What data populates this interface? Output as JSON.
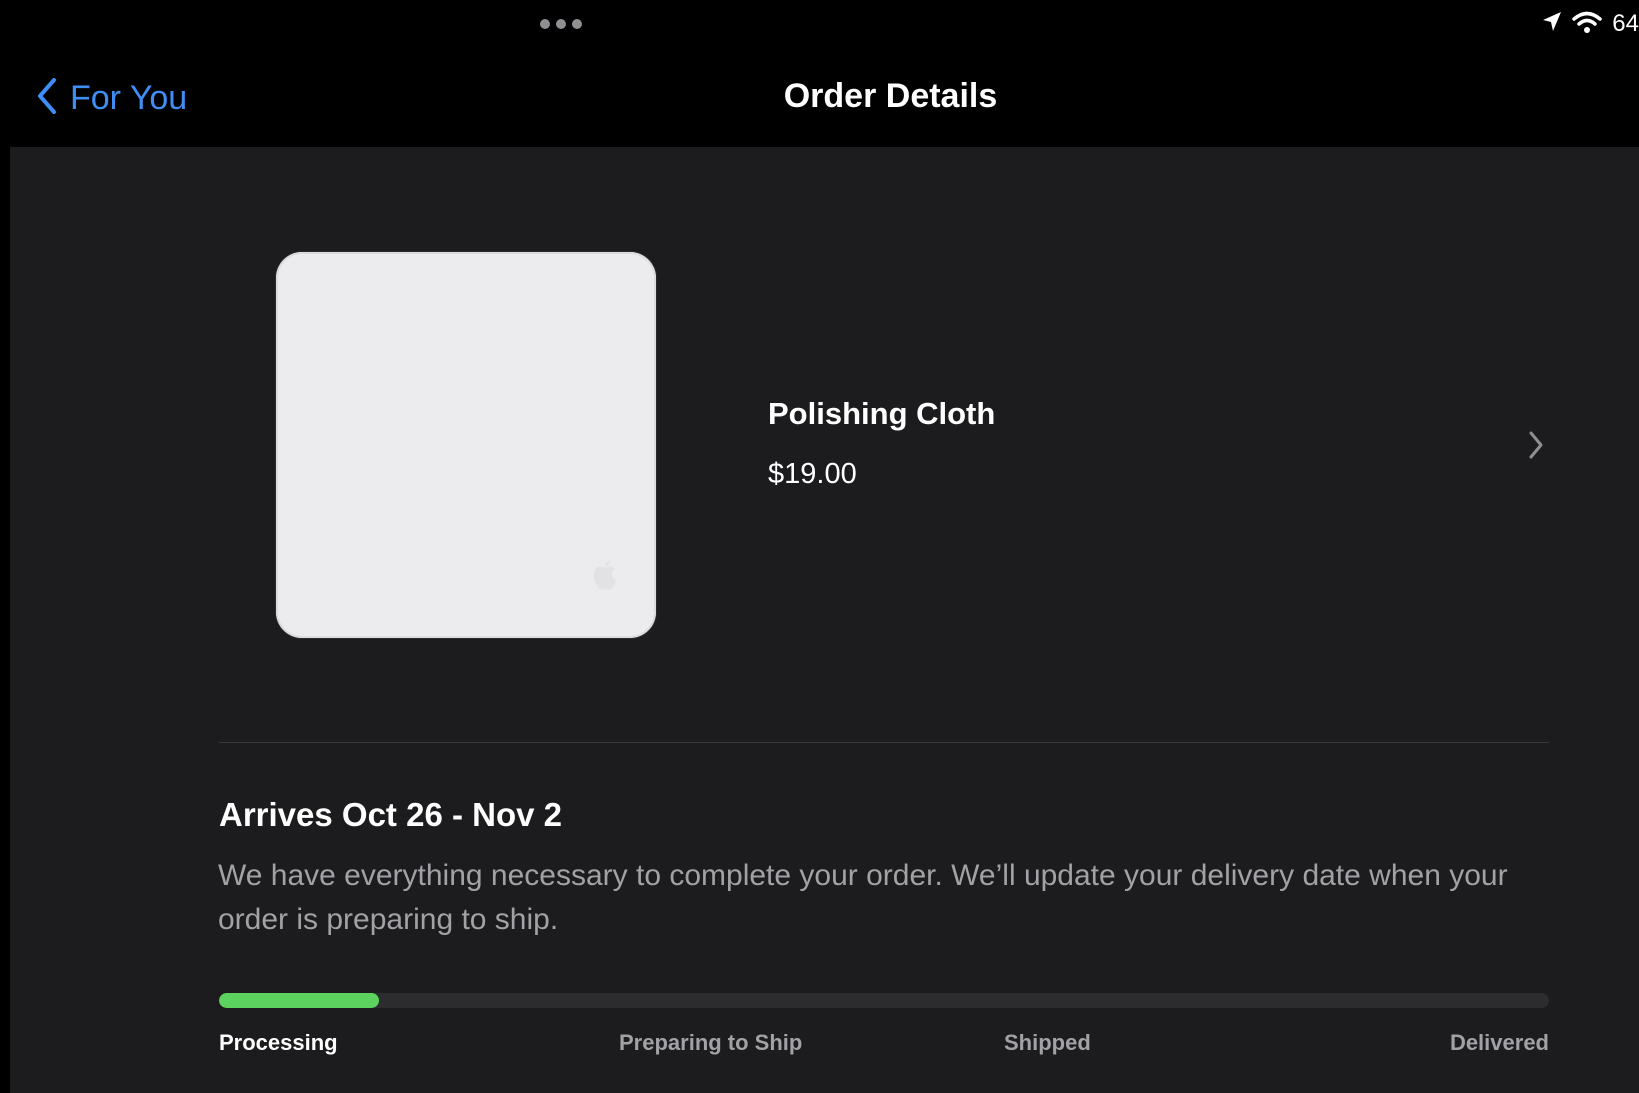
{
  "status_bar": {
    "battery": "64",
    "icons": [
      "location-arrow-icon",
      "wifi-icon"
    ]
  },
  "nav": {
    "back_label": "For You",
    "title": "Order Details"
  },
  "product": {
    "name": "Polishing Cloth",
    "price": "$19.00"
  },
  "delivery": {
    "arrives": "Arrives Oct 26 - Nov 2",
    "description": "We have everything necessary to complete your order. We’ll update your delivery date when your order is preparing to ship.",
    "progress_fraction": 0.12,
    "progress_color": "#5dd35f",
    "current_step_index": 0,
    "steps": [
      "Processing",
      "Preparing to Ship",
      "Shipped",
      "Delivered"
    ]
  },
  "colors": {
    "accent": "#3f8ef6",
    "background": "#1c1c1e",
    "secondary_text": "#a1a1a6"
  }
}
